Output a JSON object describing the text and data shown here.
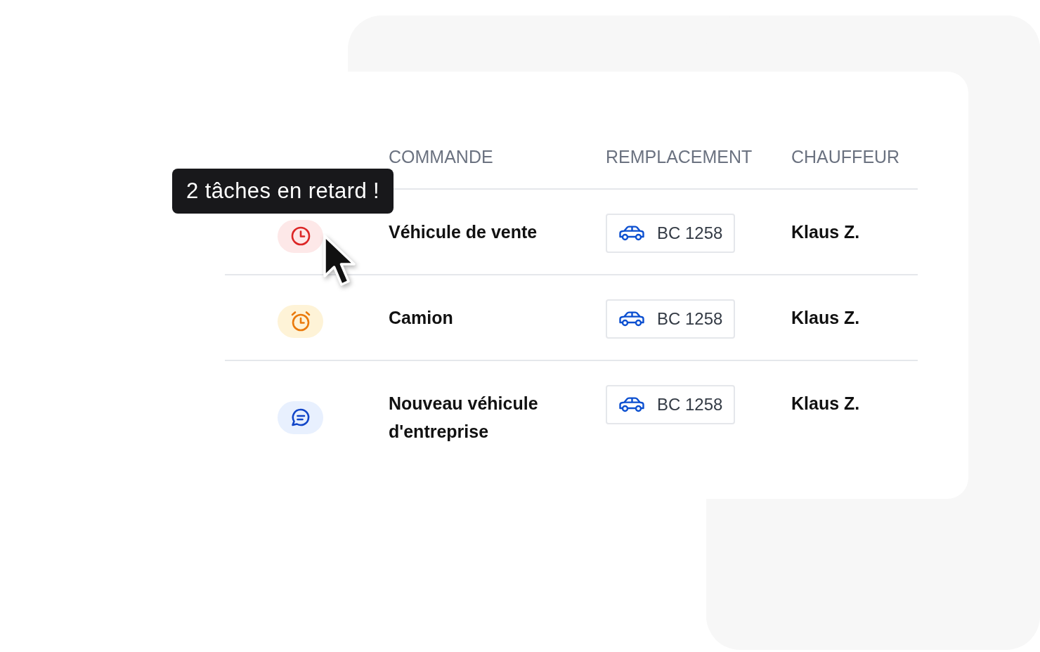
{
  "table": {
    "columns": [
      "COMMANDE",
      "REMPLACEMENT",
      "CHAUFFEUR"
    ],
    "rows": [
      {
        "kind": "overdue",
        "order": "Véhicule de vente",
        "plate": "BC 1258",
        "driver": "Klaus Z."
      },
      {
        "kind": "alarm",
        "order": "Camion",
        "plate": "BC 1258",
        "driver": "Klaus Z."
      },
      {
        "kind": "message",
        "order": "Nouveau véhicule d'entreprise",
        "plate": "BC 1258",
        "driver": "Klaus Z."
      }
    ]
  },
  "tooltip": {
    "text": "2 tâches en retard !"
  }
}
